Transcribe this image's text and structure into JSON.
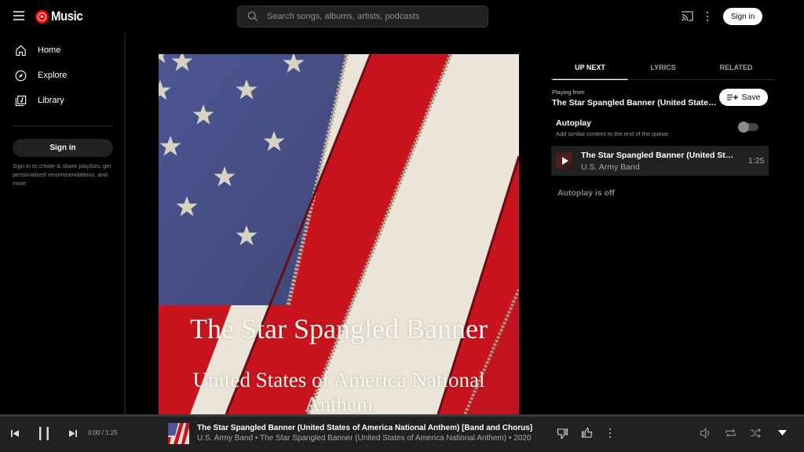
{
  "app": {
    "logo_text": "Music",
    "brand_color": "#ff0000"
  },
  "header": {
    "search_placeholder": "Search songs, albums, artists, podcasts",
    "signin_label": "Sign in",
    "icons": [
      "menu-icon",
      "search-icon",
      "cast-icon",
      "more-vert-icon"
    ]
  },
  "sidebar": {
    "items": [
      {
        "label": "Home",
        "icon": "home-icon"
      },
      {
        "label": "Explore",
        "icon": "explore-icon"
      },
      {
        "label": "Library",
        "icon": "library-icon"
      }
    ],
    "signin_label": "Sign in",
    "signin_note": "Sign in to create & share playlists, get personalized recommendations, and more."
  },
  "artwork": {
    "title_line1": "The Star Spangled Banner",
    "title_line2": "United States of America National Anthem"
  },
  "panel": {
    "tabs": [
      {
        "label": "UP NEXT",
        "active": true
      },
      {
        "label": "LYRICS",
        "active": false
      },
      {
        "label": "RELATED",
        "active": false
      }
    ],
    "playing_from_label": "Playing from",
    "playing_from_title": "The Star Spangled Banner (United States of America National Anthem)",
    "save_label": "Save",
    "autoplay_title": "Autoplay",
    "autoplay_sub": "Add similar content to the end of the queue",
    "autoplay_enabled": false,
    "queue": [
      {
        "title": "The Star Spangled Banner (United States of America National Anthem) [Band and Chorus]",
        "artist": "U.S. Army Band",
        "duration": "1:25"
      }
    ],
    "autoplay_off_label": "Autoplay is off"
  },
  "player": {
    "time": "0:00 / 1:25",
    "progress": 0,
    "title": "The Star Spangled Banner (United States of America National Anthem) [Band and Chorus]",
    "subtitle": "U.S. Army Band • The Star Spangled Banner (United States of America National Anthem) • 2020",
    "icons": [
      "previous-icon",
      "pause-icon",
      "next-icon",
      "dislike-icon",
      "like-icon",
      "more-vert-icon",
      "volume-icon",
      "repeat-icon",
      "shuffle-icon",
      "expand-icon"
    ]
  }
}
